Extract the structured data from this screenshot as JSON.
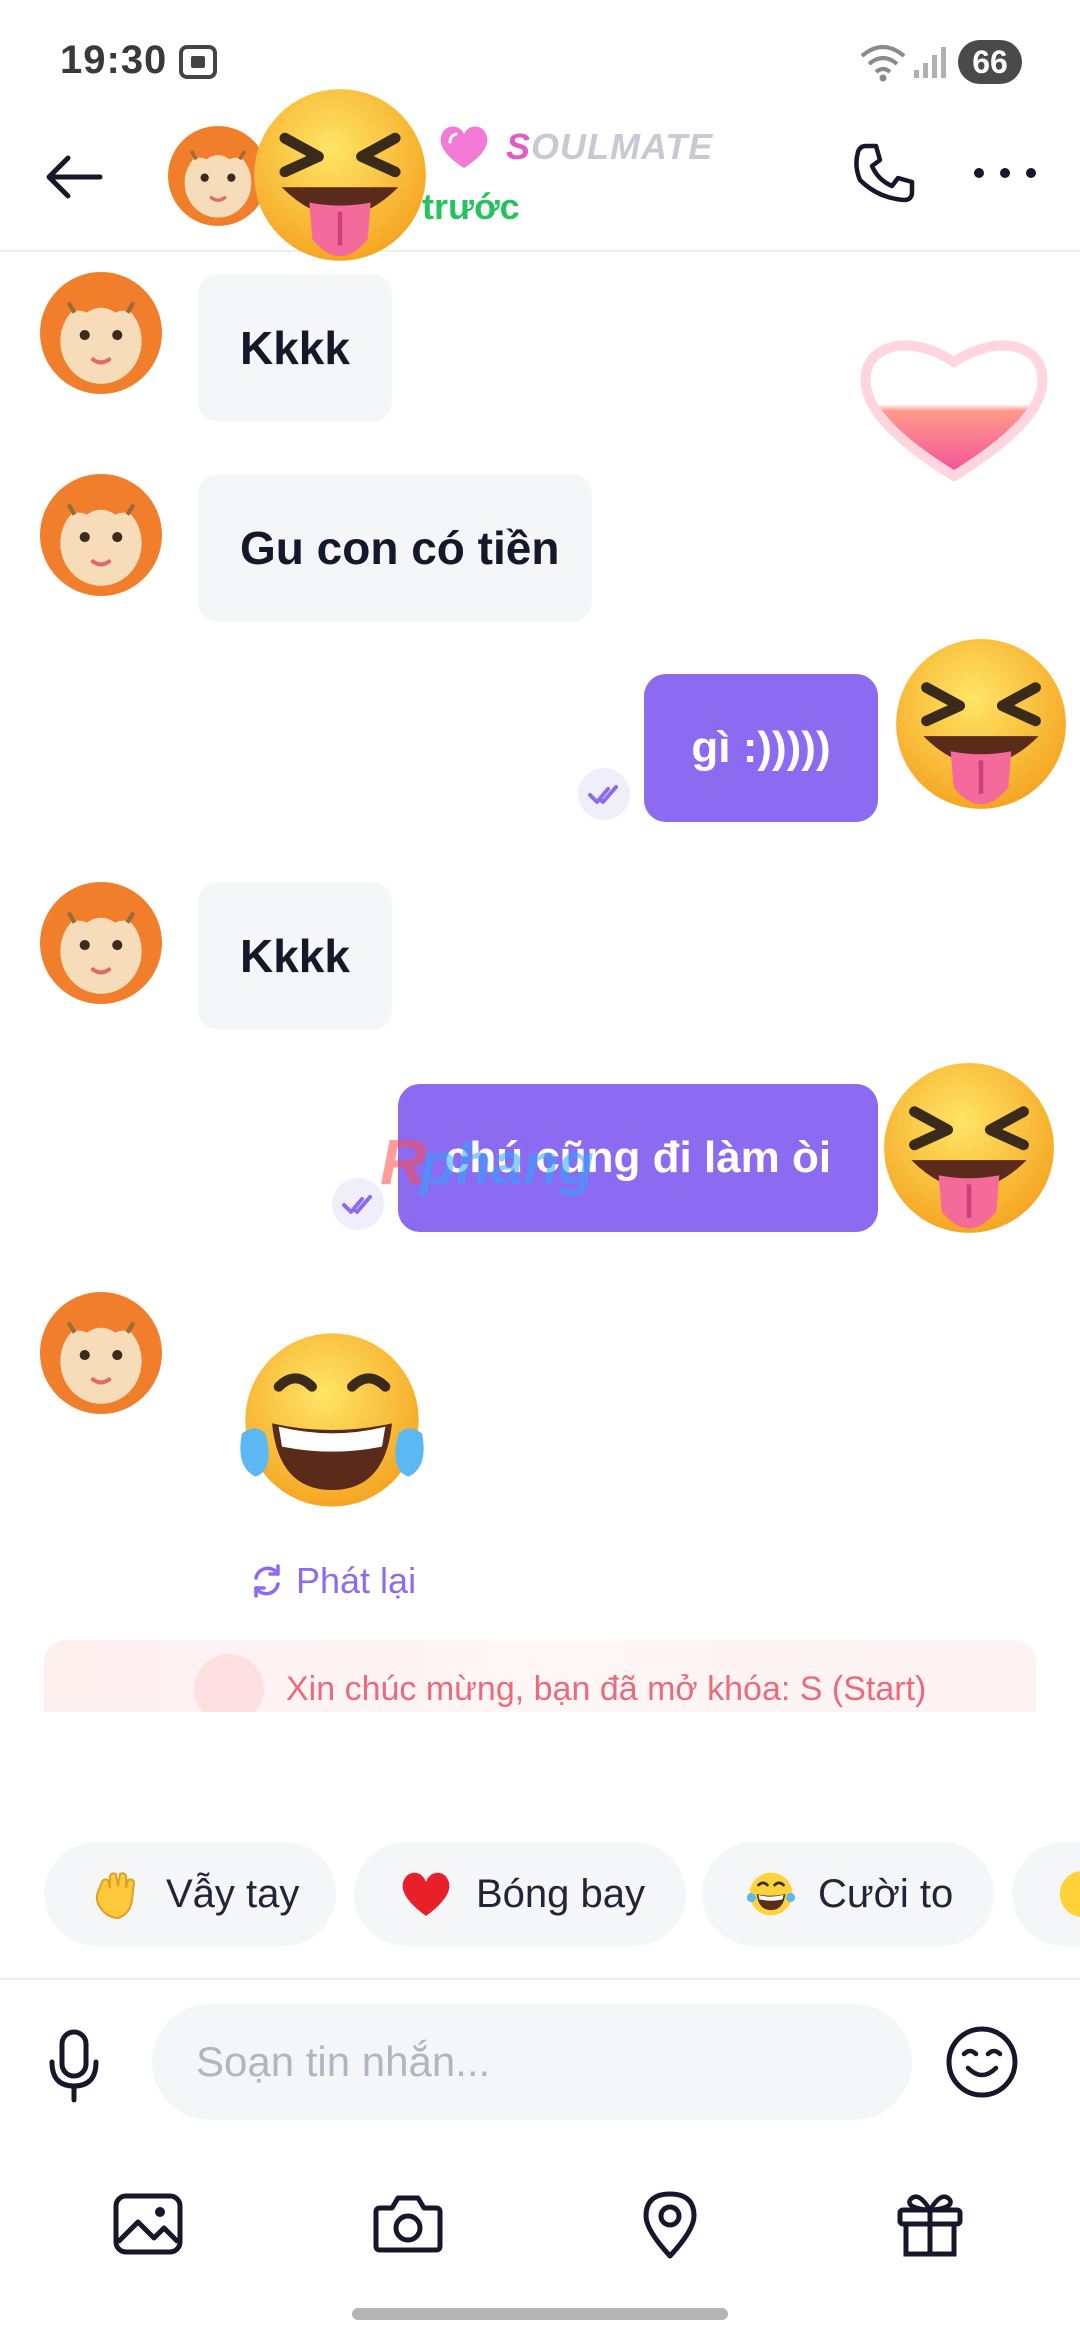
{
  "status_bar": {
    "time": "19:30",
    "battery": "66"
  },
  "header": {
    "soulmate_first": "S",
    "soulmate_rest": "OULMATE",
    "last_seen": "trước"
  },
  "messages": [
    {
      "side": "in",
      "text": "Kkkk"
    },
    {
      "side": "in",
      "text": "Gu con có tiền"
    },
    {
      "side": "out",
      "text": "gì :)))))"
    },
    {
      "side": "in",
      "text": "Kkkk"
    },
    {
      "side": "out",
      "text": "chú cũng đi làm òi"
    },
    {
      "side": "in",
      "sticker": "face-with-tears-of-joy"
    }
  ],
  "replay_label": "Phát lại",
  "unlock_banner": "Xin chúc mừng, bạn đã mở khóa: S (Start)",
  "quick_reactions": [
    {
      "label": "Vẫy tay",
      "icon": "waving-hand-icon"
    },
    {
      "label": "Bóng bay",
      "icon": "red-heart-icon"
    },
    {
      "label": "Cười to",
      "icon": "laughing-face-icon"
    }
  ],
  "composer": {
    "placeholder": "Soạn tin nhắn..."
  },
  "bottom_bar": [
    "image-icon",
    "camera-icon",
    "location-icon",
    "gift-icon"
  ],
  "colors": {
    "accent": "#8d6bf0",
    "bubble_in": "#f5f6f8",
    "online_green": "#25c35b",
    "soulmate_pink": "#e25bc4"
  }
}
